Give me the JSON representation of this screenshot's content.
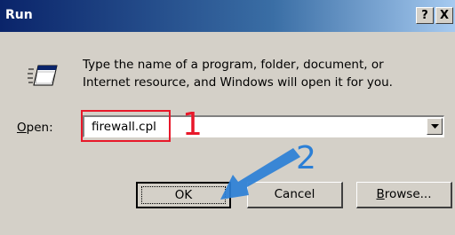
{
  "window": {
    "title": "Run",
    "help_label": "?",
    "close_label": "X"
  },
  "prompt": {
    "line1": "Type the name of a program, folder, document, or",
    "line2": "Internet resource, and Windows will open it for you."
  },
  "open_field": {
    "label_accel": "O",
    "label_rest": "pen:",
    "value": "firewall.cpl"
  },
  "buttons": {
    "ok_label": "OK",
    "cancel_label": "Cancel",
    "browse_accel": "B",
    "browse_rest": "rowse..."
  },
  "annotations": {
    "step1": "1",
    "step2": "2"
  },
  "colors": {
    "highlight_red": "#e8182a",
    "arrow_blue": "#2b7fd6",
    "dialog_gray": "#d4d0c8",
    "title_blue": "#0a246a"
  },
  "icons": {
    "run": "run-program-icon",
    "dropdown": "chevron-down-icon",
    "arrow": "pointer-arrow-icon"
  }
}
